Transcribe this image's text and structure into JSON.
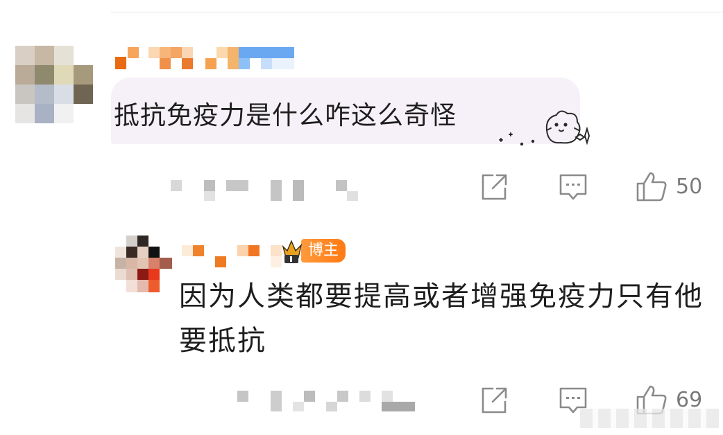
{
  "comment": {
    "text": "抵抗免疫力是什么咋这么奇怪",
    "like_count": "50"
  },
  "reply": {
    "badge_label": "博主",
    "text": "因为人类都要提高或者增强免疫力只有他要抵抗",
    "like_count": "69"
  },
  "icons": {
    "share": "share-icon",
    "comment": "comment-icon",
    "like": "thumbs-up-icon"
  },
  "colors": {
    "badge": "#ff8a1f",
    "bubble": "#f6f1f8",
    "icon": "#8a8a8a"
  }
}
